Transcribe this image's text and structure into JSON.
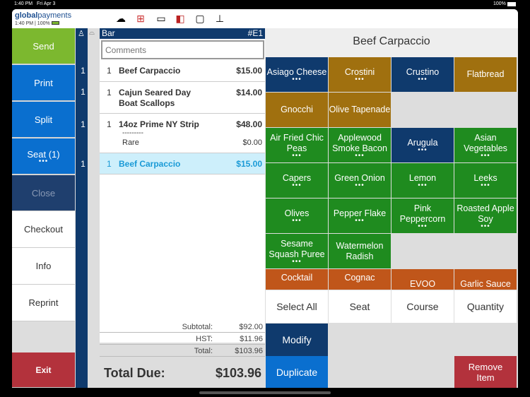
{
  "status": {
    "time": "1:40 PM",
    "date": "Fri Apr 3",
    "battery": "100%"
  },
  "header": {
    "logo_bold": "global",
    "logo_rest": "payments",
    "time": "1:40 PM",
    "battery": "100%"
  },
  "left": {
    "send": "Send",
    "print": "Print",
    "split": "Split",
    "seat": "Seat (1)",
    "close": "Close",
    "checkout": "Checkout",
    "info": "Info",
    "reprint": "Reprint",
    "exit": "Exit"
  },
  "order": {
    "location": "Bar",
    "check": "#E1",
    "comments_placeholder": "Comments",
    "items": [
      {
        "seat": "1",
        "qty": "1",
        "name": "Beef Carpaccio",
        "price": "$15.00"
      },
      {
        "seat": "1",
        "qty": "1",
        "name": "Cajun Seared Day Boat Scallops",
        "price": "$14.00"
      },
      {
        "seat": "1",
        "qty": "1",
        "name": "14oz Prime NY Strip",
        "price": "$48.00",
        "mod_sep": "---------",
        "mod": "Rare",
        "mod_price": "$0.00"
      },
      {
        "seat": "1",
        "qty": "1",
        "name": "Beef Carpaccio",
        "price": "$15.00"
      }
    ],
    "subtotal_label": "Subtotal:",
    "subtotal": "$92.00",
    "hst_label": "HST:",
    "hst": "$11.96",
    "total_label": "Total:",
    "total": "$103.96",
    "due_label": "Total Due:",
    "due": "$103.96"
  },
  "panel": {
    "title": "Beef Carpaccio",
    "colors": {
      "navy": "#0f3a6d",
      "brown": "#a0700f",
      "green": "#1f8b1f",
      "orange": "#c0561a"
    },
    "cells": [
      [
        {
          "l": "Asiago Cheese",
          "c": "navy",
          "d": true
        },
        {
          "l": "Crostini",
          "c": "brown",
          "d": true
        },
        {
          "l": "Crustino",
          "c": "navy",
          "d": true
        },
        {
          "l": "Flatbread",
          "c": "brown",
          "d": false
        }
      ],
      [
        {
          "l": "Gnocchi",
          "c": "brown",
          "d": false
        },
        {
          "l": "Olive Tapenade",
          "c": "brown",
          "d": false
        },
        null,
        null
      ],
      [
        {
          "l": "Air Fried Chic Peas",
          "c": "green",
          "d": true
        },
        {
          "l": "Applewood Smoke Bacon",
          "c": "green",
          "d": true
        },
        {
          "l": "Arugula",
          "c": "navy",
          "d": true
        },
        {
          "l": "Asian Vegetables",
          "c": "green",
          "d": true
        }
      ],
      [
        {
          "l": "Capers",
          "c": "green",
          "d": true
        },
        {
          "l": "Green Onion",
          "c": "green",
          "d": true
        },
        {
          "l": "Lemon",
          "c": "green",
          "d": true
        },
        {
          "l": "Leeks",
          "c": "green",
          "d": true
        }
      ],
      [
        {
          "l": "Olives",
          "c": "green",
          "d": true
        },
        {
          "l": "Pepper Flake",
          "c": "green",
          "d": true
        },
        {
          "l": "Pink Peppercorn",
          "c": "green",
          "d": true
        },
        {
          "l": "Roasted Apple Soy",
          "c": "green",
          "d": true
        }
      ],
      [
        {
          "l": "Sesame Squash Puree",
          "c": "green",
          "d": true
        },
        {
          "l": "Watermelon Radish",
          "c": "green",
          "d": false
        },
        null,
        null
      ],
      [
        {
          "l": "Cocktail",
          "c": "orange",
          "d": false
        },
        {
          "l": "Cognac",
          "c": "orange",
          "d": false
        },
        {
          "l": "EVOO",
          "c": "orange",
          "d": false
        },
        {
          "l": "Garlic Sauce",
          "c": "orange",
          "d": false
        }
      ]
    ],
    "select_all": "Select All",
    "seat": "Seat",
    "course": "Course",
    "quantity": "Quantity",
    "modify": "Modify",
    "duplicate": "Duplicate",
    "remove": "Remove Item"
  }
}
